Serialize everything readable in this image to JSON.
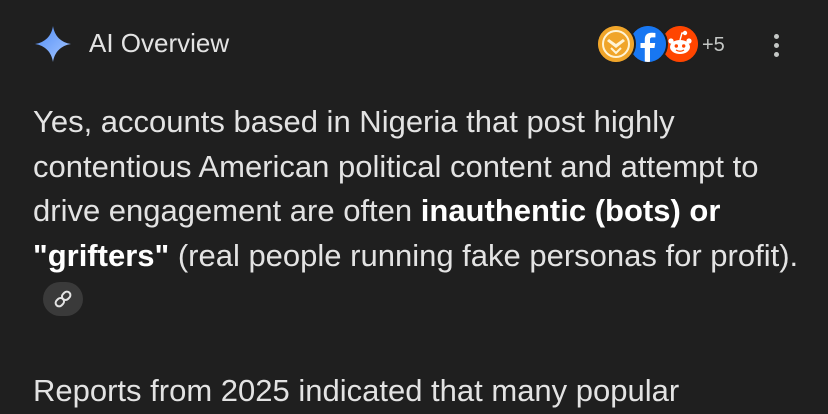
{
  "header": {
    "title": "AI Overview",
    "sources": [
      {
        "icon": "gold-emblem-source-icon",
        "color": "#f0a52a"
      },
      {
        "icon": "facebook-icon",
        "color": "#1877f2"
      },
      {
        "icon": "reddit-icon",
        "color": "#ff4500"
      }
    ],
    "more_sources": "+5",
    "menu_icon": "more-vert-icon"
  },
  "content": {
    "p1_text_1": "Yes, accounts based in Nigeria that post highly contentious American political content and attempt to drive engagement are often ",
    "p1_bold": "inauthentic (bots) or \"grifters\"",
    "p1_text_2": " (real people running fake personas for profit).",
    "link_icon": "link-icon",
    "p2_text": "Reports from 2025 indicated that many popular"
  },
  "colors": {
    "background": "#1f1f1f",
    "text": "#e3e3e3",
    "sparkle_start": "#4f8cf7",
    "sparkle_end": "#9fc3ff"
  }
}
